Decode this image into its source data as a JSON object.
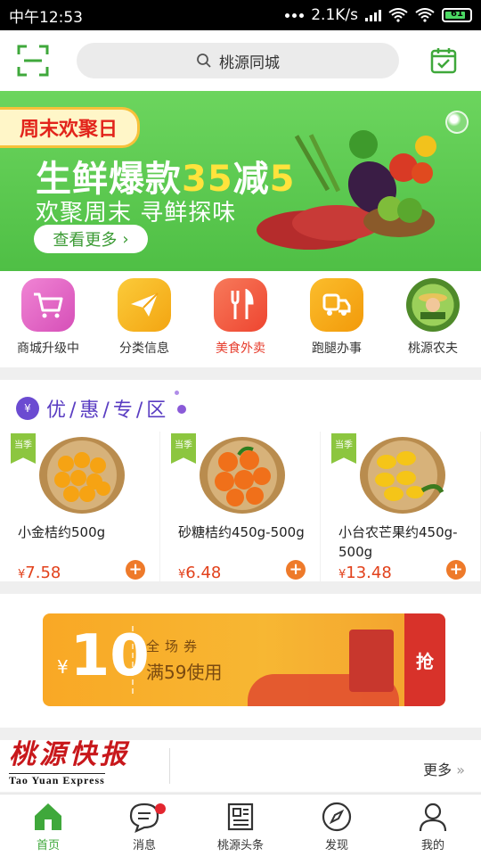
{
  "status": {
    "time": "中午12:53",
    "speed": "2.1K/s",
    "battery": "61"
  },
  "search": {
    "placeholder": "桃源同城"
  },
  "banner": {
    "tag": "周末欢聚日",
    "headline_pre": "生鲜爆款",
    "headline_num": "35",
    "headline_mid": "减",
    "headline_num2": "5",
    "sub": "欢聚周末 寻鲜探味",
    "more": "查看更多"
  },
  "menu": [
    {
      "label": "商城升级中",
      "icon": "cart-icon",
      "color": "#e763c5"
    },
    {
      "label": "分类信息",
      "icon": "paper-plane-icon",
      "color": "#f7b21a"
    },
    {
      "label": "美食外卖",
      "icon": "fork-knife-icon",
      "color": "#f2553a"
    },
    {
      "label": "跑腿办事",
      "icon": "delivery-icon",
      "color": "#f5a70e"
    },
    {
      "label": "桃源农夫",
      "icon": "farmer-avatar-icon",
      "color": "#6aa33b"
    }
  ],
  "promo": {
    "title": "优/惠/专/区",
    "badge": "¥",
    "season_tag": "当季",
    "products": [
      {
        "name": "小金桔约500g",
        "price": "7.58",
        "currency": "¥"
      },
      {
        "name": "砂糖桔约450g-500g",
        "price": "6.48",
        "currency": "¥"
      },
      {
        "name": "小台农芒果约450g-500g",
        "price": "13.48",
        "currency": "¥"
      }
    ]
  },
  "coupon": {
    "currency": "¥",
    "amount": "10",
    "kind": "全场券",
    "condition": "满59使用",
    "grab": "抢"
  },
  "news": {
    "logo_cn": "桃源快报",
    "logo_en": "Tao Yuan Express",
    "more": "更多"
  },
  "tabs": [
    {
      "label": "首页",
      "icon": "home-icon",
      "active": true
    },
    {
      "label": "消息",
      "icon": "message-icon",
      "badge": true
    },
    {
      "label": "桃源头条",
      "icon": "news-icon"
    },
    {
      "label": "发现",
      "icon": "compass-icon"
    },
    {
      "label": "我的",
      "icon": "user-icon"
    }
  ]
}
